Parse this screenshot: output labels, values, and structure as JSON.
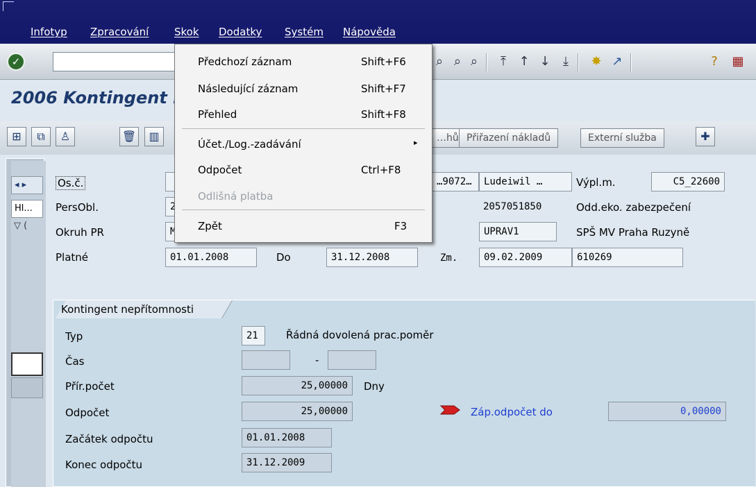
{
  "menubar": {
    "items": [
      "Infotyp",
      "Zpracování",
      "Skok",
      "Dodatky",
      "Systém",
      "Nápověda"
    ]
  },
  "toolbar": {
    "command_value": ""
  },
  "page": {
    "title": "2006 Kontingent nepřítomností Zobrazení"
  },
  "app_toolbar": {
    "buttons": [
      "…hů",
      "Přiřazení nákladů",
      "Externí služba"
    ]
  },
  "header": {
    "osc_label": "Os.č.",
    "osc_value": "…9072…",
    "name_value": "Ludeiwil …",
    "vyplm_label": "Výpl.m.",
    "vyplm_value": "C5_22600",
    "persobl_label": "PersObl.",
    "persobl_value": "2",
    "persobl_code": "2057051850",
    "persobl_text": "Odd.eko. zabezpečení",
    "okruh_label": "Okruh PR",
    "okruh_value": "M",
    "okruh_code": "UPRAV1",
    "okruh_text": "SPŠ MV Praha Ruzyně",
    "platne_label": "Platné",
    "platne_from": "01.01.2008",
    "do_label": "Do",
    "platne_to": "31.12.2008",
    "zm_label": "Zm.",
    "zm_date": "09.02.2009",
    "zm_user": "610269"
  },
  "leftnav": {
    "tab_label": "Hl..."
  },
  "group": {
    "title": "Kontingent nepřítomnosti",
    "typ_label": "Typ",
    "typ_code": "21",
    "typ_text": "Řádná dovolená prac.poměr",
    "cas_label": "Čas",
    "cas_sep": "-",
    "prir_label": "Přír.počet",
    "prir_value": "25,00000",
    "prir_unit": "Dny",
    "odpocet_label": "Odpočet",
    "odpocet_value": "25,00000",
    "zap_label": "Záp.odpočet do",
    "zap_value": "0,00000",
    "zacatek_label": "Začátek odpočtu",
    "zacatek_value": "01.01.2008",
    "konec_label": "Konec odpočtu",
    "konec_value": "31.12.2009"
  },
  "dropdown": {
    "items": [
      {
        "label": "Předchozí záznam",
        "shortcut": "Shift+F6"
      },
      {
        "label": "Následující záznam",
        "shortcut": "Shift+F7"
      },
      {
        "label": "Přehled",
        "shortcut": "Shift+F8"
      },
      {
        "label": "Účet./Log.-zadávání",
        "shortcut": "▸"
      },
      {
        "label": "Odpočet",
        "shortcut": "Ctrl+F8"
      },
      {
        "label": "Odlišná platba",
        "shortcut": ""
      },
      {
        "label": "Zpět",
        "shortcut": "F3"
      }
    ]
  },
  "colors": {
    "menubar": "#14186a",
    "title": "#1d3a6e",
    "link": "#1f3fd0",
    "arrow": "#d31f1f"
  }
}
